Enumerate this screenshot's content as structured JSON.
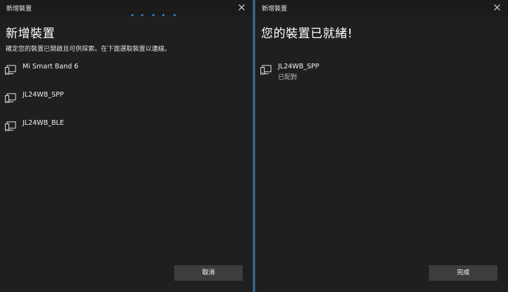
{
  "left": {
    "window_title": "新增裝置",
    "heading": "新增裝置",
    "subtitle": "確定您的裝置已開啟且可供探索。在下面選取裝置以連線。",
    "devices": [
      {
        "name": "Mi Smart Band 6"
      },
      {
        "name": "JL24WB_SPP"
      },
      {
        "name": "JL24WB_BLE"
      }
    ],
    "cancel_label": "取消"
  },
  "right": {
    "window_title": "新增裝置",
    "heading": "您的裝置已就緒!",
    "device": {
      "name": "JL24WB_SPP",
      "status": "已配對"
    },
    "done_label": "完成"
  },
  "icons": {
    "close": "close-icon",
    "device": "device-icon"
  },
  "colors": {
    "background": "#1f1f1f",
    "accent": "#2b7fd6",
    "button": "#3d3d3d"
  }
}
